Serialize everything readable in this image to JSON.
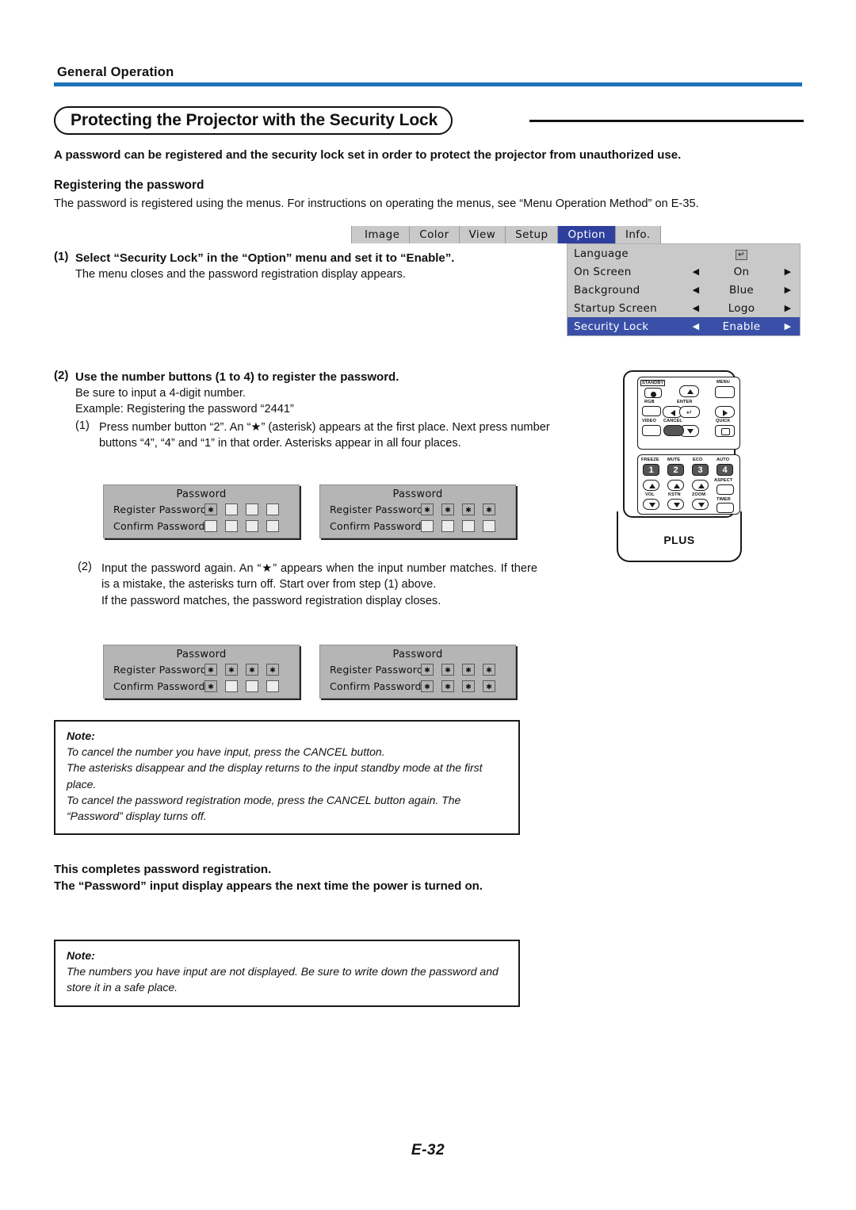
{
  "header": {
    "running_head": "General Operation",
    "rule_color": "#1b72b8"
  },
  "section": {
    "title": "Protecting the Projector with the Security Lock"
  },
  "intro": {
    "lead": "A password can be registered and the security lock set in order to protect the projector from unauthorized use.",
    "sub_heading": "Registering the password",
    "sub_paragraph": "The password is registered using the menus. For instructions on operating the menus, see “Menu Operation Method” on E-35."
  },
  "step1": {
    "number": "(1)",
    "bold": "Select “Security Lock” in the “Option” menu and set it to “Enable”.",
    "detail": "The menu closes and the password registration display appears."
  },
  "osd_menu": {
    "tabs": [
      {
        "label": "Image",
        "active": false
      },
      {
        "label": "Color",
        "active": false
      },
      {
        "label": "View",
        "active": false
      },
      {
        "label": "Setup",
        "active": false
      },
      {
        "label": "Option",
        "active": true
      },
      {
        "label": "Info.",
        "active": false
      }
    ],
    "rows": [
      {
        "label": "Language",
        "left_arrow": "",
        "value": "",
        "right_arrow": "",
        "enter_glyph": "↵",
        "selected": false
      },
      {
        "label": "On Screen",
        "left_arrow": "◀",
        "value": "On",
        "right_arrow": "▶",
        "selected": false
      },
      {
        "label": "Background",
        "left_arrow": "◀",
        "value": "Blue",
        "right_arrow": "▶",
        "selected": false
      },
      {
        "label": "Startup Screen",
        "left_arrow": "◀",
        "value": "Logo",
        "right_arrow": "▶",
        "selected": false
      },
      {
        "label": "Security Lock",
        "left_arrow": "◀",
        "value": "Enable",
        "right_arrow": "▶",
        "selected": true
      }
    ],
    "highlight_color": "#3a50a8",
    "panel_color": "#c9c9c9"
  },
  "step2": {
    "number": "(2)",
    "bold": "Use the number buttons (1 to 4) to register the password.",
    "line1": "Be sure to input a 4-digit number.",
    "line2": "Example: Registering the password “2441”",
    "sub1": {
      "number": "(1)",
      "text": "Press number button “2”. An “★” (asterisk) appears at the first place. Next press number buttons “4”, “4” and “1” in that order. Asterisks appear in all four places."
    },
    "sub2": {
      "number": "(2)",
      "text": "Input the password again. An “★” appears when the input number matches. If there is a mistake, the asterisks turn off. Start over from step (1) above.",
      "extra": "If the password matches, the password registration display closes."
    }
  },
  "password_dialogs": [
    {
      "title": "Password",
      "register_label": "Register Password",
      "confirm_label": "Confirm Password",
      "register_cells": [
        "✱",
        "",
        "",
        ""
      ],
      "confirm_cells": [
        "",
        "",
        "",
        ""
      ]
    },
    {
      "title": "Password",
      "register_label": "Register Password",
      "confirm_label": "Confirm Password",
      "register_cells": [
        "✱",
        "✱",
        "✱",
        "✱"
      ],
      "confirm_cells": [
        "",
        "",
        "",
        ""
      ]
    },
    {
      "title": "Password",
      "register_label": "Register Password",
      "confirm_label": "Confirm Password",
      "register_cells": [
        "✱",
        "✱",
        "✱",
        "✱"
      ],
      "confirm_cells": [
        "✱",
        "",
        "",
        ""
      ]
    },
    {
      "title": "Password",
      "register_label": "Register Password",
      "confirm_label": "Confirm Password",
      "register_cells": [
        "✱",
        "✱",
        "✱",
        "✱"
      ],
      "confirm_cells": [
        "✱",
        "✱",
        "✱",
        "✱"
      ]
    }
  ],
  "remote": {
    "brand": "PLUS",
    "labels": {
      "standby": "STANDBY",
      "menu": "MENU",
      "rgb": "RGB",
      "enter": "ENTER",
      "video": "VIDEO",
      "cancel": "CANCEL",
      "quick": "QUICK",
      "freeze": "FREEZE",
      "mute": "MUTE",
      "eco": "ECO",
      "auto": "AUTO",
      "aspect": "ASPECT",
      "vol": "VOL",
      "kstn": "KSTN",
      "zoom": "ZOOM",
      "timer": "TIMER"
    },
    "number_buttons": [
      "1",
      "2",
      "3",
      "4"
    ]
  },
  "note1": {
    "title": "Note:",
    "lines": [
      "To cancel the number you have input, press the CANCEL button.",
      "The asterisks disappear and the display returns to the input standby mode at the first place.",
      "To cancel the password registration mode, press the CANCEL button again. The “Password” display turns off."
    ]
  },
  "closing": {
    "line1": "This completes password registration.",
    "line2": "The “Password” input display appears the next time the power is turned on."
  },
  "note2": {
    "title": "Note:",
    "lines": [
      "The numbers you have input are not displayed. Be sure to write down the password and store it in a safe place."
    ]
  },
  "folio": {
    "page": "E-32"
  }
}
